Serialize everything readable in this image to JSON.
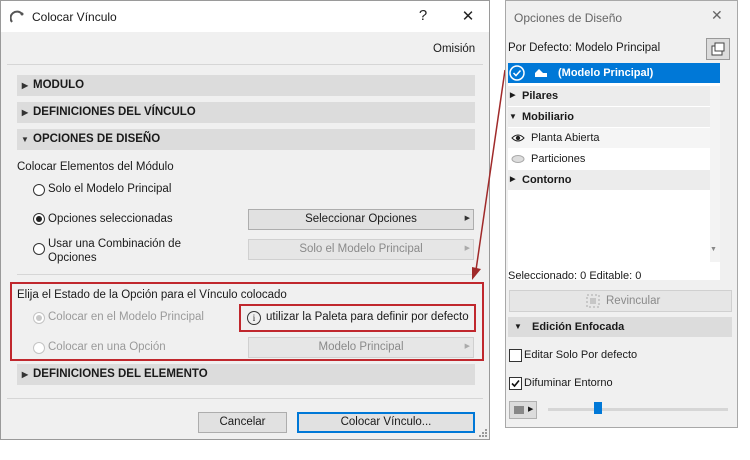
{
  "dialog": {
    "title": "Colocar Vínculo",
    "help_symbol": "?",
    "close_symbol": "✕",
    "defaults_link": "Omisión",
    "sections": {
      "modulo": "MODULO",
      "definiciones_vinculo": "DEFINICIONES DEL VÍNCULO",
      "opciones_diseno": "OPCIONES DE DISEÑO",
      "definiciones_elemento": "DEFINICIONES DEL ELEMENTO"
    },
    "colocar_elementos": {
      "label": "Colocar Elementos del Módulo",
      "opt1": "Solo el Modelo Principal",
      "opt2": "Opciones seleccionadas",
      "opt3_line1": "Usar una Combinación de",
      "opt3_line2": "Opciones",
      "seleccionar_btn": "Seleccionar Opciones",
      "solo_btn": "Solo el Modelo Principal"
    },
    "estado_opcion": {
      "label": "Elija el Estado de la Opción para el Vínculo colocado",
      "opt1": "Colocar en el Modelo Principal",
      "opt2": "Colocar en una Opción",
      "info_icon": "i",
      "info_text": "utilizar la Paleta para definir por defecto",
      "modelo_btn": "Modelo Principal"
    },
    "buttons": {
      "cancel": "Cancelar",
      "ok": "Colocar Vínculo..."
    }
  },
  "palette": {
    "title": "Opciones de Diseño",
    "close_symbol": "✕",
    "default_label": "Por Defecto: Modelo Principal",
    "selected_row": "(Modelo Principal)",
    "items": {
      "pilares": "Pilares",
      "mobiliario": "Mobiliario",
      "planta_abierta": "Planta Abierta",
      "particiones": "Particiones",
      "contorno": "Contorno"
    },
    "status": "Seleccionado: 0 Editable: 0",
    "revincular": "Revincular",
    "edicion_enfocada": "Edición Enfocada",
    "editar_solo": "Editar Solo Por defecto",
    "difuminar": "Difuminar Entorno",
    "slider_level_percent": 28
  },
  "colors": {
    "accent": "#0078d7",
    "highlight_box": "#c0272d",
    "arrow": "#a02a2a"
  }
}
